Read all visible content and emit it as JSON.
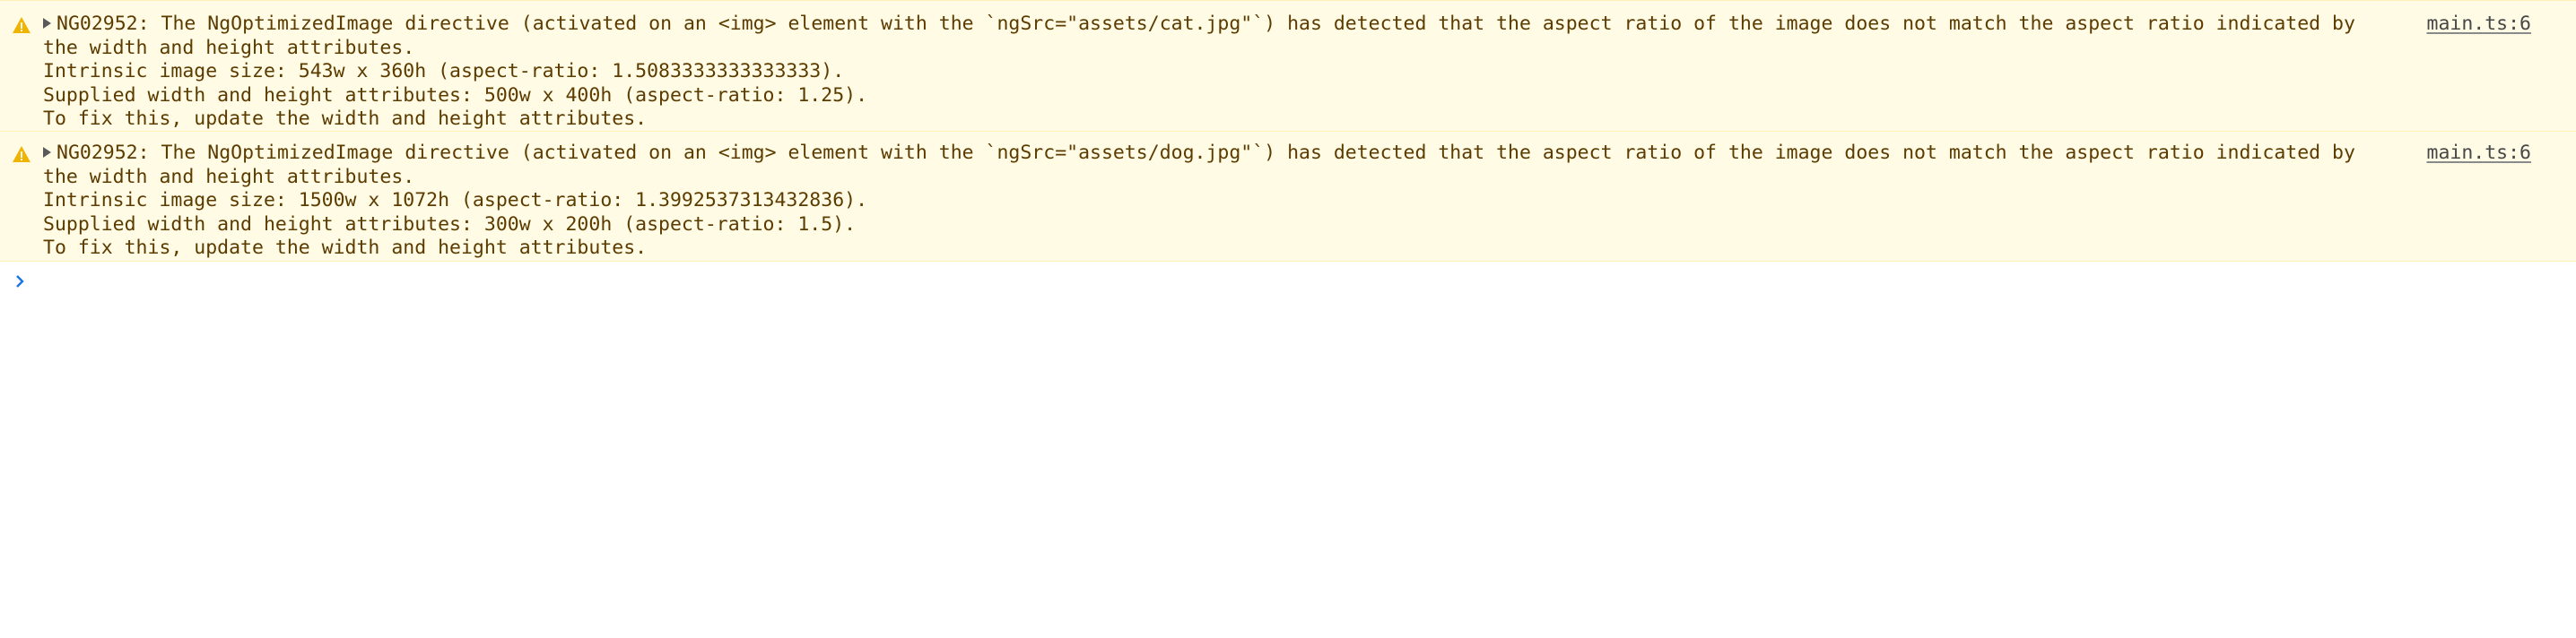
{
  "console": {
    "messages": [
      {
        "level": "warning",
        "icon": "warning-icon",
        "first_line": "NG02952: The NgOptimizedImage directive (activated on an <img> element with the `ngSrc=\"assets/cat.jpg\"`) has detected that the aspect ratio of the image does not match the aspect ratio indicated by",
        "wrap_line": "the width and height attributes.",
        "detail_lines": [
          "Intrinsic image size: 543w x 360h (aspect-ratio: 1.5083333333333333).",
          "Supplied width and height attributes: 500w x 400h (aspect-ratio: 1.25).",
          "To fix this, update the width and height attributes."
        ],
        "source": "main.ts:6"
      },
      {
        "level": "warning",
        "icon": "warning-icon",
        "first_line": "NG02952: The NgOptimizedImage directive (activated on an <img> element with the `ngSrc=\"assets/dog.jpg\"`) has detected that the aspect ratio of the image does not match the aspect ratio indicated by",
        "wrap_line": "the width and height attributes.",
        "detail_lines": [
          "Intrinsic image size: 1500w x 1072h (aspect-ratio: 1.3992537313432836).",
          "Supplied width and height attributes: 300w x 200h (aspect-ratio: 1.5).",
          "To fix this, update the width and height attributes."
        ],
        "source": "main.ts:6"
      }
    ],
    "prompt": {
      "icon": "chevron-right-icon",
      "value": ""
    }
  },
  "colors": {
    "warning_background": "#fffbe5",
    "warning_border": "#fff1b8",
    "warning_text": "#5c3b00",
    "warning_icon": "#f0b400",
    "prompt_chevron": "#1a73e8"
  }
}
